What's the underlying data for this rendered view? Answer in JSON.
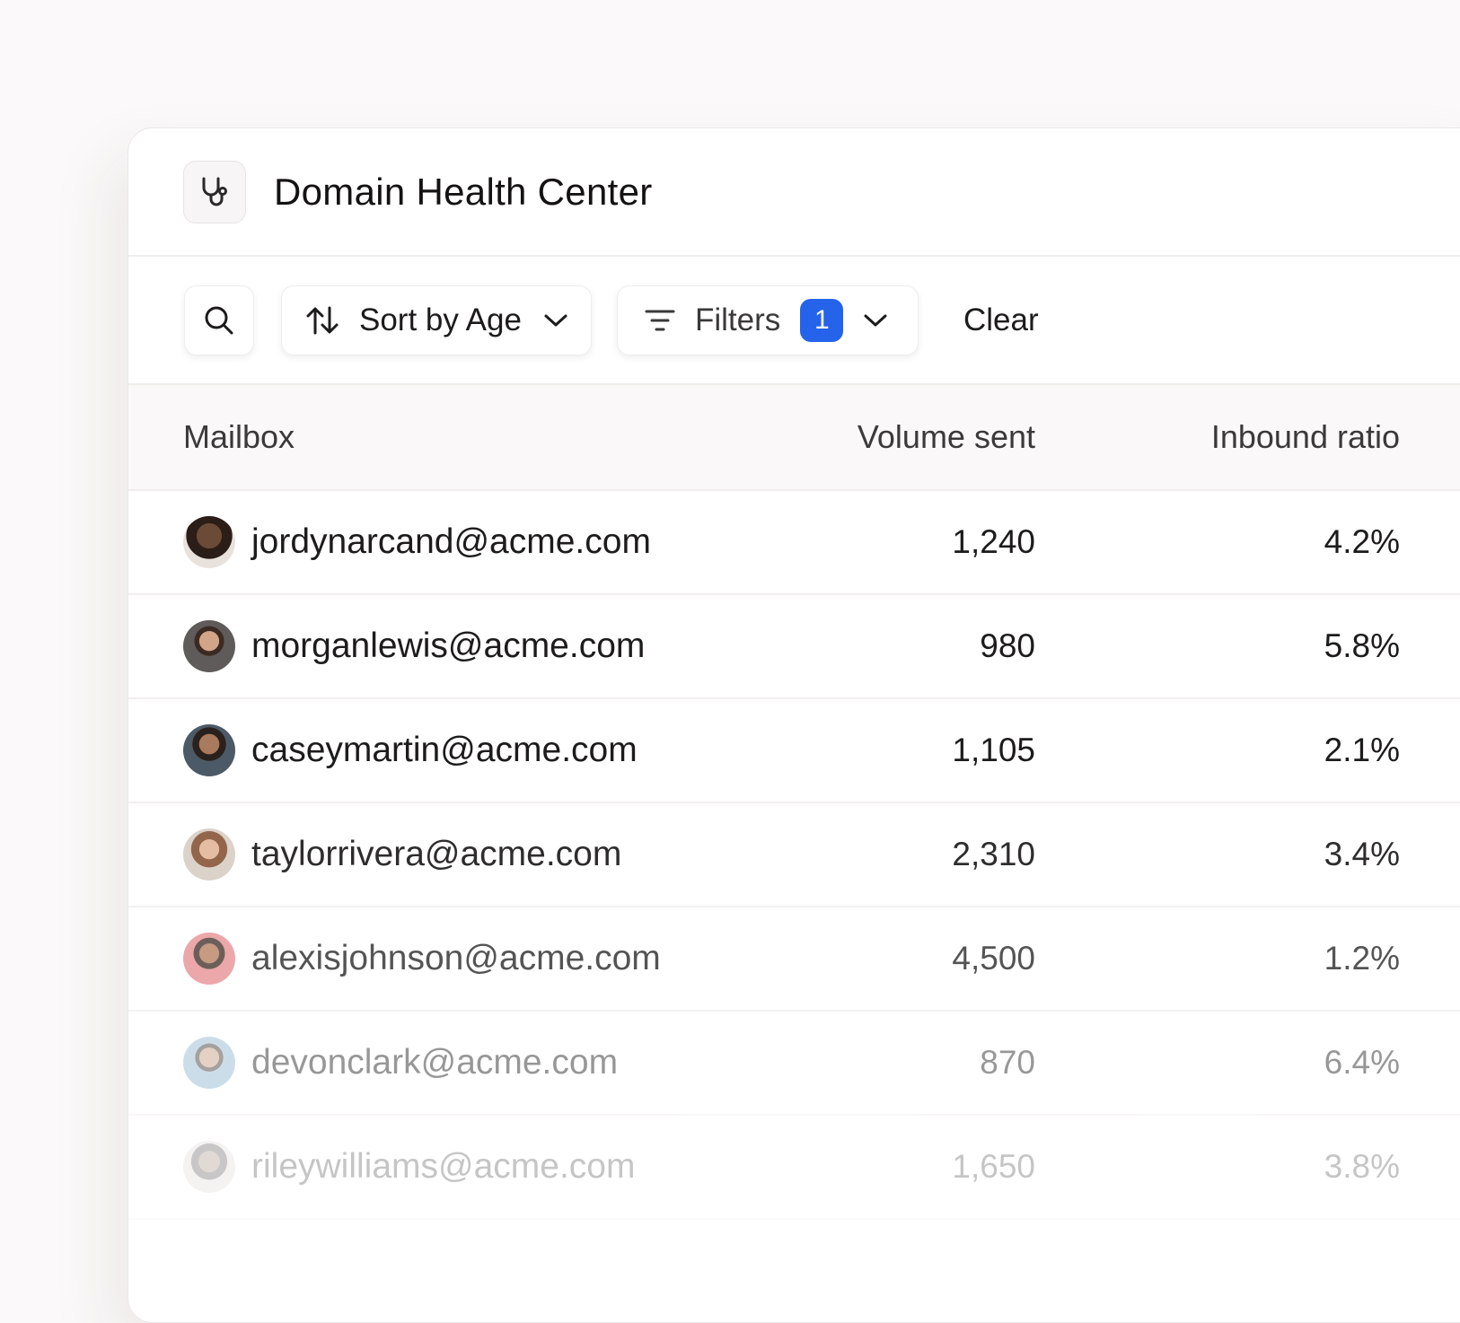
{
  "header": {
    "title": "Domain Health Center",
    "icon": "stethoscope-icon"
  },
  "toolbar": {
    "sort_label": "Sort by Age",
    "filters_label": "Filters",
    "filters_count": "1",
    "clear_label": "Clear",
    "accent": "#2563eb"
  },
  "table": {
    "columns": [
      "Mailbox",
      "Volume sent",
      "Inbound ratio"
    ],
    "rows": [
      {
        "email": "jordynarcand@acme.com",
        "volume": "1,240",
        "ratio": "4.2%"
      },
      {
        "email": "morganlewis@acme.com",
        "volume": "980",
        "ratio": "5.8%"
      },
      {
        "email": "caseymartin@acme.com",
        "volume": "1,105",
        "ratio": "2.1%"
      },
      {
        "email": "taylorrivera@acme.com",
        "volume": "2,310",
        "ratio": "3.4%"
      },
      {
        "email": "alexisjohnson@acme.com",
        "volume": "4,500",
        "ratio": "1.2%"
      },
      {
        "email": "devonclark@acme.com",
        "volume": "870",
        "ratio": "6.4%"
      },
      {
        "email": "rileywilliams@acme.com",
        "volume": "1,650",
        "ratio": "3.8%"
      }
    ]
  }
}
